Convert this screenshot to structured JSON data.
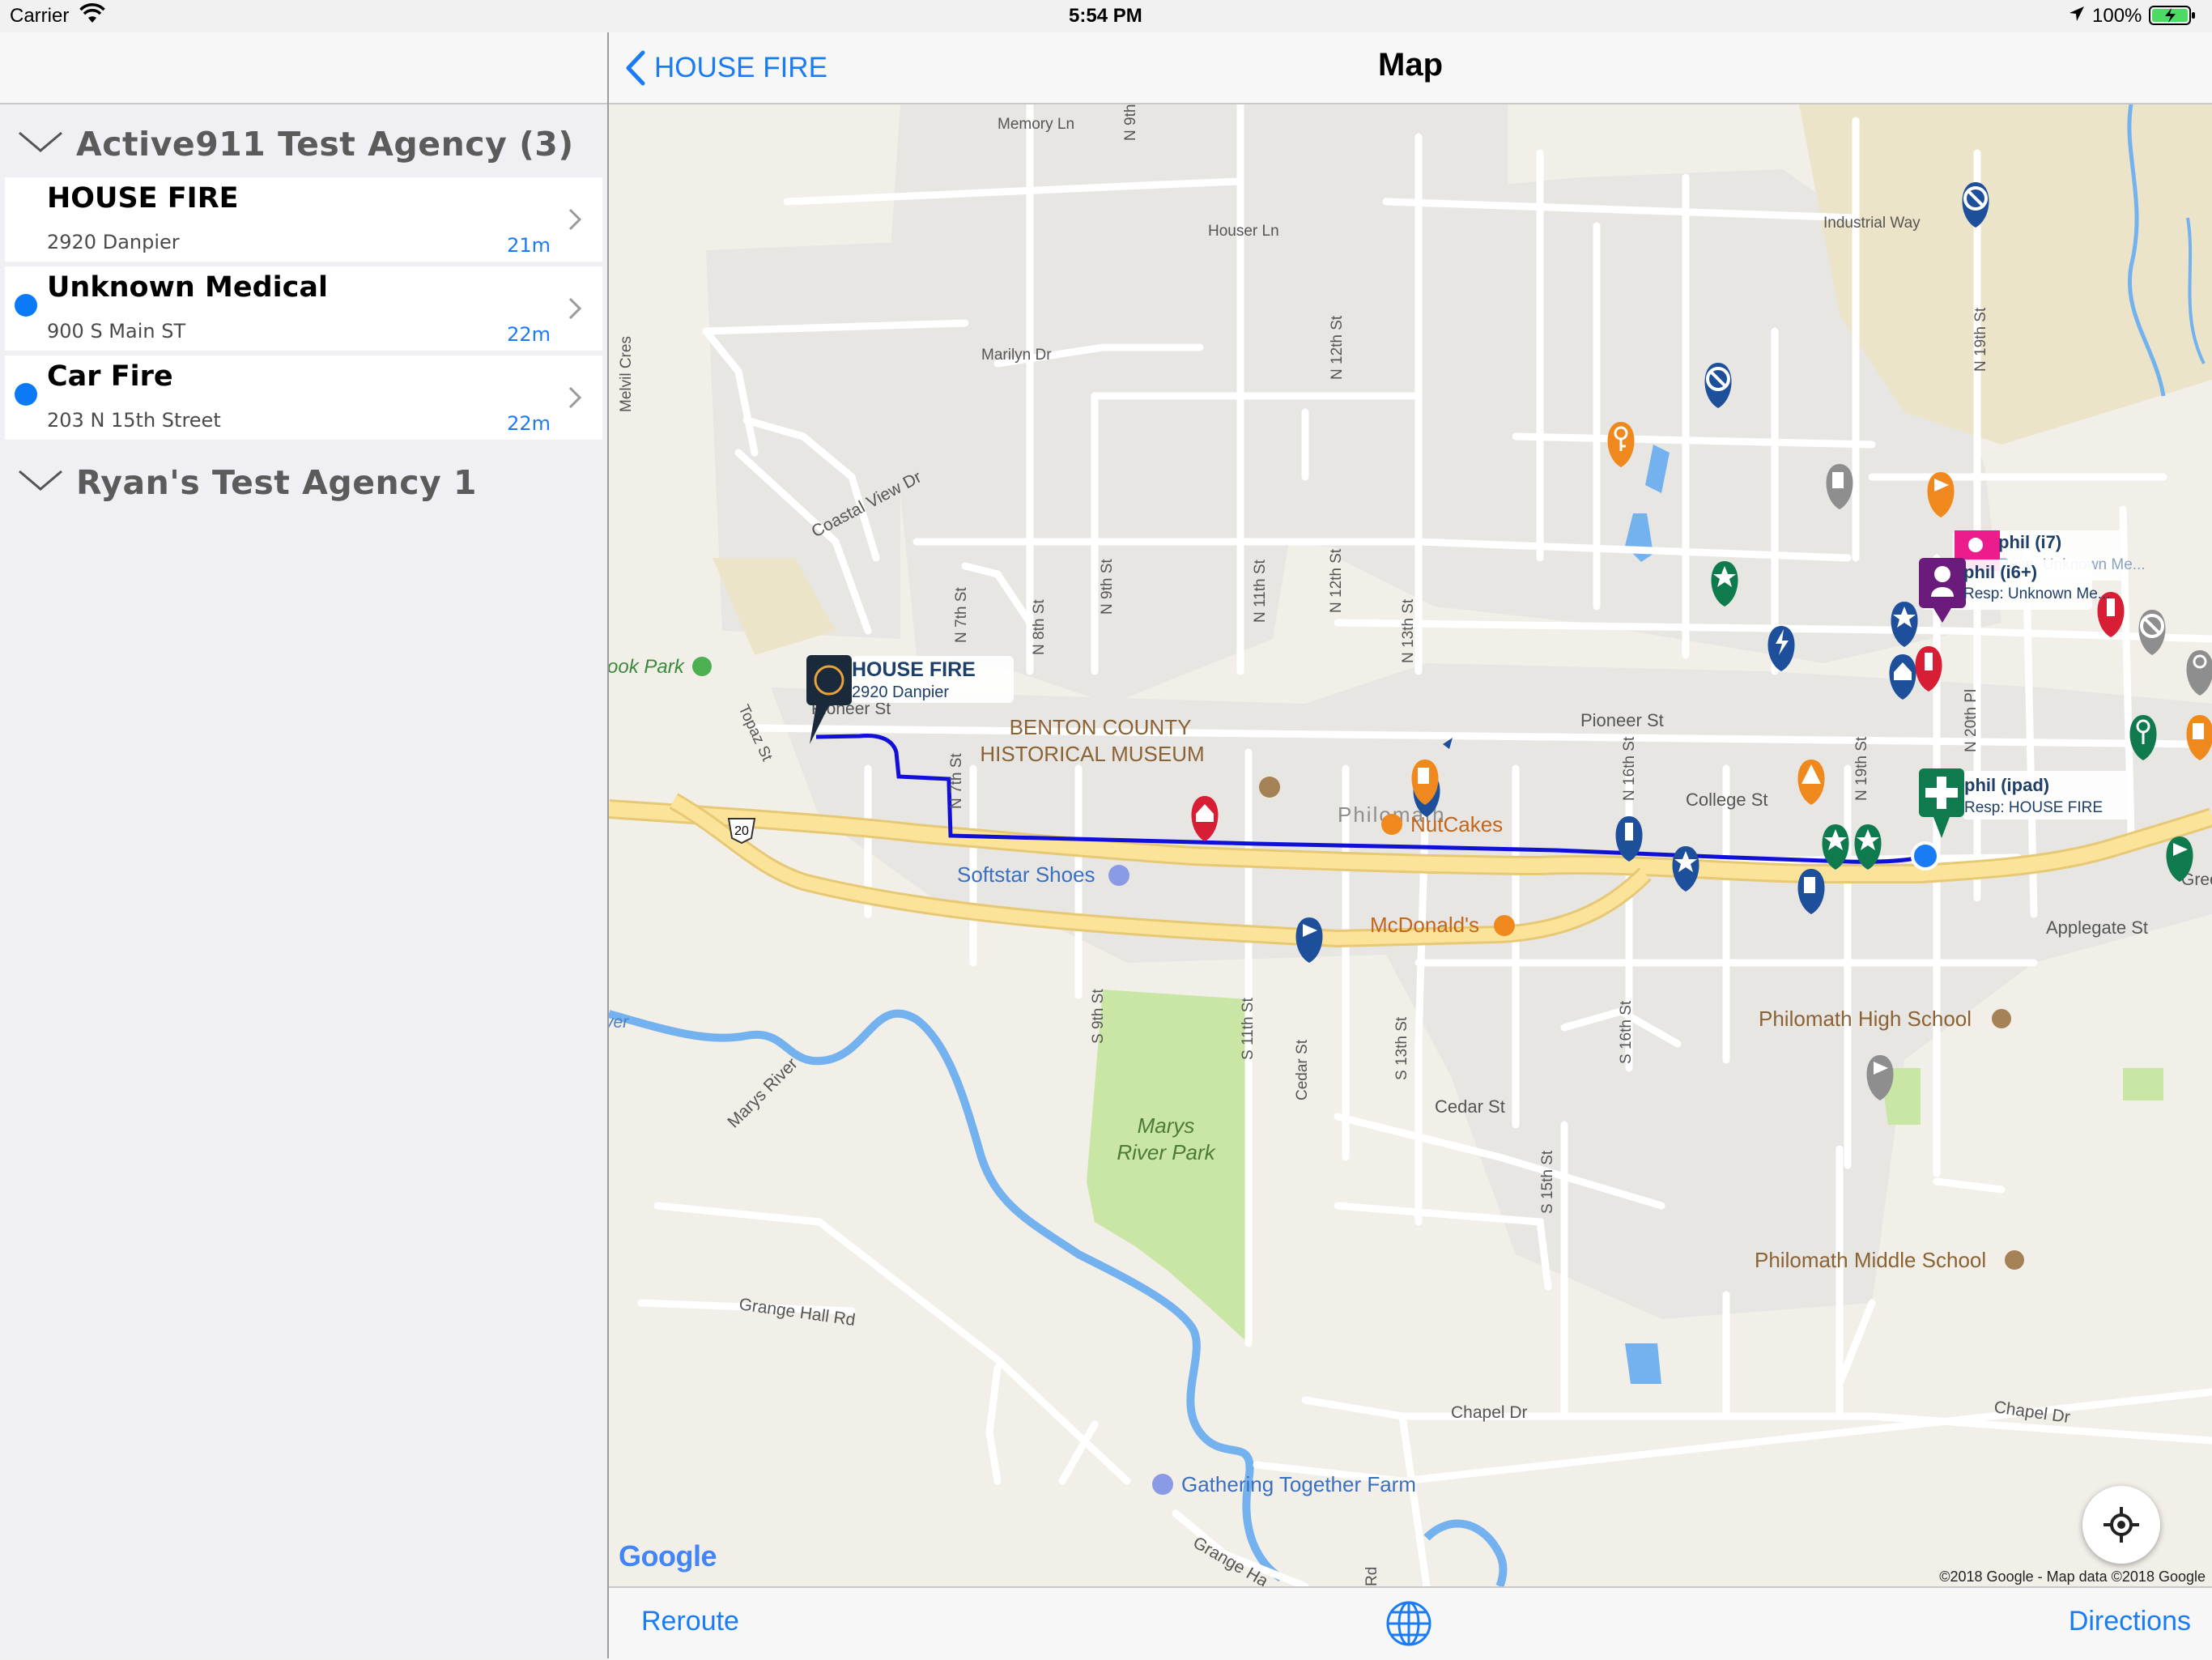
{
  "status_bar": {
    "carrier": "Carrier",
    "time": "5:54 PM",
    "battery": "100%"
  },
  "sidebar": {
    "groups": [
      {
        "title": "Active911 Test Agency (3)",
        "incidents": [
          {
            "title": "HOUSE FIRE",
            "address": "2920 Danpier",
            "time": "21m",
            "unread": false
          },
          {
            "title": "Unknown Medical",
            "address": "900 S Main ST",
            "time": "22m",
            "unread": true
          },
          {
            "title": "Car Fire",
            "address": "203 N 15th Street",
            "time": "22m",
            "unread": true
          }
        ]
      },
      {
        "title": "Ryan's Test Agency 1",
        "incidents": []
      }
    ]
  },
  "nav": {
    "back_label": "HOUSE FIRE",
    "title": "Map"
  },
  "map": {
    "incident_callout": {
      "title": "HOUSE FIRE",
      "subtitle": "2920 Danpier"
    },
    "responders": [
      {
        "name": "phil (i7)",
        "detail": "Resp: Unknown Me...",
        "color": "#ec1c8c"
      },
      {
        "name": "phil (i6+)",
        "detail": "Resp: Unknown Me...",
        "color": "#6a1b7c"
      },
      {
        "name": "phil (ipad)",
        "detail": "Resp: HOUSE FIRE",
        "color": "#0f7a4e"
      }
    ],
    "streets": {
      "memory_ln": "Memory Ln",
      "n_9th_top": "N 9th",
      "houser_ln": "Houser Ln",
      "industrial_way": "Industrial Way",
      "marilyn_dr": "Marilyn Dr",
      "n_12th_st_top": "N 12th St",
      "n_19th_st": "N 19th St",
      "melvil_cres": "Melvil Cres",
      "coastal_view_dr": "Coastal View Dr",
      "n_9th_st": "N 9th St",
      "n_11th_st": "N 11th St",
      "n_12th_st": "N 12th St",
      "n_13th_st": "N 13th St",
      "n_8th_st": "N 8th St",
      "n_7th_st_top": "N 7th St",
      "n_7th_st": "N 7th St",
      "topaz_st": "Topaz St",
      "pioneer_st_w": "Pioneer St",
      "pioneer_st_e": "Pioneer St",
      "n_16th_st": "N 16th St",
      "college_st": "College St",
      "n_19th_st_low": "N 19th St",
      "n_20th_pl": "N 20th Pl",
      "route_20": "20",
      "philomath": "Philomath",
      "applegate_st": "Applegate St",
      "s_9th_st": "S 9th St",
      "s_11th_st": "S 11th St",
      "cedar_st_v": "Cedar St",
      "s_13th_st": "S 13th St",
      "s_16th_st": "S 16th St",
      "cedar_st": "Cedar St",
      "s_15th_st": "S 15th St",
      "marys_river": "Marys River",
      "grange_hall_rd": "Grange Hall Rd",
      "grange_hall_rd_2": "Grange Ha",
      "chapel_dr_w": "Chapel Dr",
      "chapel_dr_e": "Chapel Dr",
      "rd_bottom": "Rd",
      "river_w": "ver",
      "gree": "Gree"
    },
    "places": {
      "brook_park": "ook Park",
      "museum_line1": "BENTON COUNTY",
      "museum_line2": "HISTORICAL MUSEUM",
      "nutcakes": "NutCakes",
      "softstar": "Softstar Shoes",
      "mcdonalds": "McDonald's",
      "marys_park_line1": "Marys",
      "marys_park_line2": "River Park",
      "high_school": "Philomath High School",
      "middle_school": "Philomath Middle School",
      "farm": "Gathering Together Farm"
    },
    "logo": "Google",
    "attribution": "©2018 Google - Map data ©2018 Google"
  },
  "toolbar": {
    "reroute": "Reroute",
    "directions": "Directions"
  },
  "colors": {
    "accent": "#1a7cf5",
    "route": "#1010d8",
    "pin_blue": "#1d4f9b",
    "pin_orange": "#f0891d",
    "pin_green": "#0f7a4e",
    "pin_red": "#d81e35",
    "pin_gray": "#8e8e8e",
    "road": "#ffffff",
    "highway": "#fbe39a",
    "river": "#73b2ee",
    "park": "#c9e6a5",
    "urban": "#e8e6e3"
  }
}
